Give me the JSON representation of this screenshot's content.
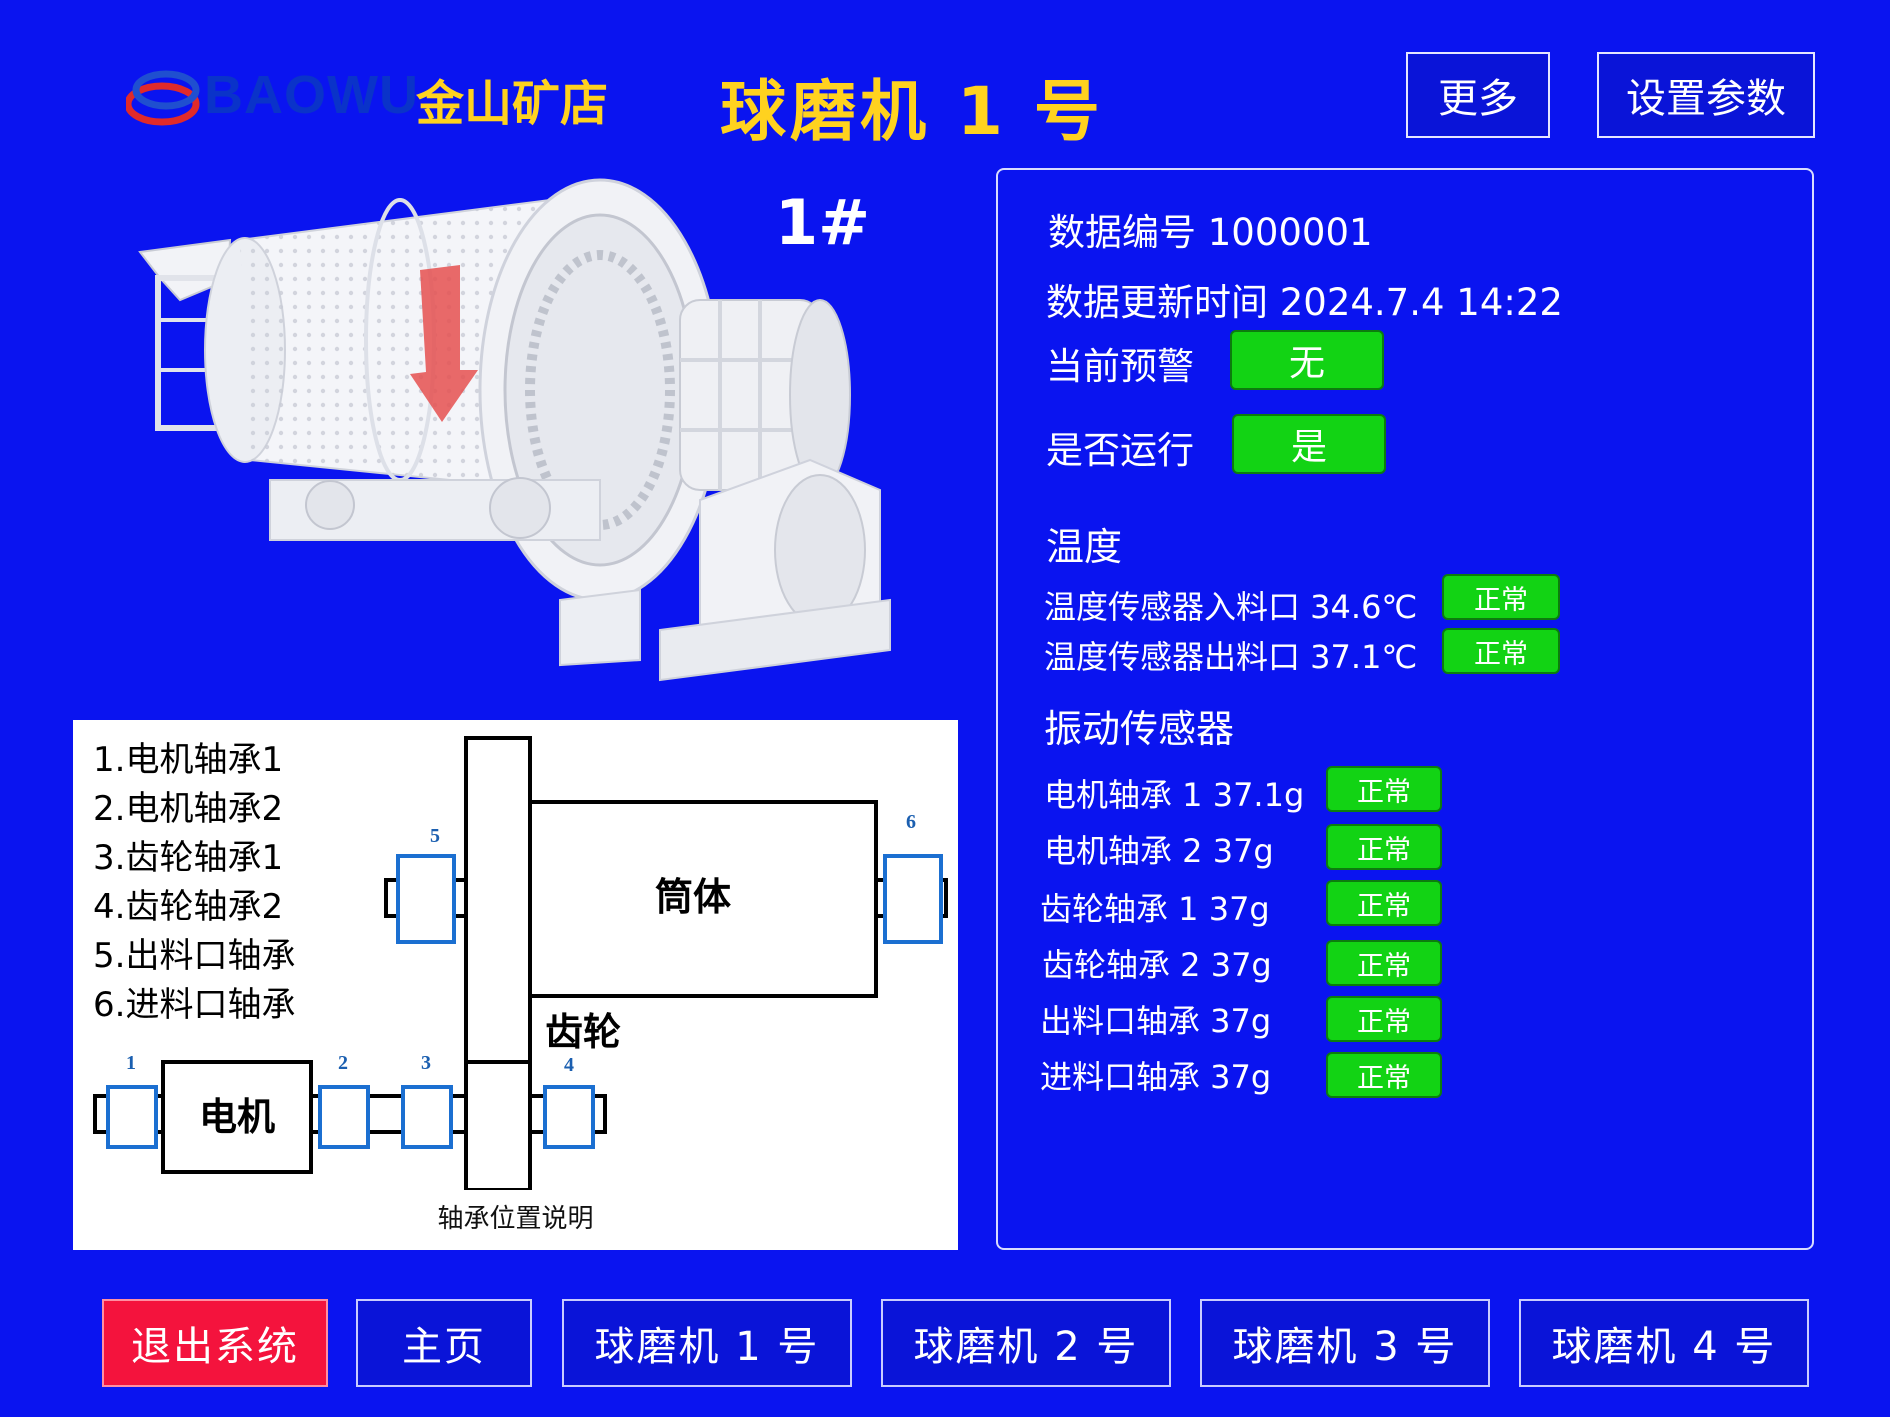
{
  "header": {
    "brand": "BAOWU",
    "brand_cn": "金山矿店",
    "title": "球磨机 1 号",
    "more_label": "更多",
    "settings_label": "设置参数"
  },
  "machine": {
    "unit_label": "1#"
  },
  "diagram": {
    "legend": [
      "1.电机轴承1",
      "2.电机轴承2",
      "3.齿轮轴承1",
      "4.齿轮轴承2",
      "5.出料口轴承",
      "6.进料口轴承"
    ],
    "labels": {
      "drum": "筒体",
      "gear": "齿轮",
      "motor": "电机"
    },
    "bearing_numbers": [
      "1",
      "2",
      "3",
      "4",
      "5",
      "6"
    ],
    "caption": "轴承位置说明"
  },
  "panel": {
    "data_id": "数据编号 1000001",
    "update_time": "数据更新时间 2024.7.4 14:22",
    "warning_label": "当前预警",
    "warning_value": "无",
    "running_label": "是否运行",
    "running_value": "是",
    "temperature_title": "温度",
    "temperatures": [
      {
        "label": "温度传感器入料口 34.6℃",
        "status": "正常"
      },
      {
        "label": "温度传感器出料口 37.1℃",
        "status": "正常"
      }
    ],
    "vibration_title": "振动传感器",
    "vibrations": [
      {
        "label": "电机轴承 1 37.1g",
        "status": "正常"
      },
      {
        "label": "电机轴承 2 37g",
        "status": "正常"
      },
      {
        "label": "齿轮轴承 1 37g",
        "status": "正常"
      },
      {
        "label": "齿轮轴承 2 37g",
        "status": "正常"
      },
      {
        "label": "出料口轴承 37g",
        "status": "正常"
      },
      {
        "label": "进料口轴承 37g",
        "status": "正常"
      }
    ]
  },
  "nav": {
    "exit": "退出系统",
    "home": "主页",
    "mills": [
      "球磨机 1 号",
      "球磨机 2 号",
      "球磨机 3 号",
      "球磨机 4 号"
    ]
  },
  "colors": {
    "background": "#0a14f0",
    "title": "#ffd21f",
    "ok": "#12d314",
    "danger": "#f4133d",
    "bearing": "#1b6fd1"
  }
}
